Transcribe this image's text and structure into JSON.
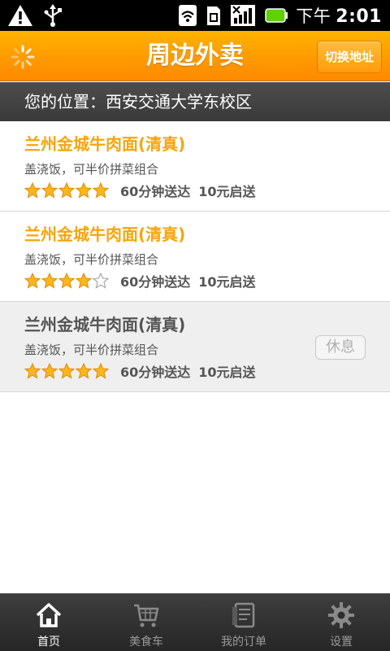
{
  "status_bar": {
    "ampm": "下午",
    "time": "2:01",
    "icons": [
      "warning-icon",
      "usb-icon",
      "wifi-icon",
      "sim-icon",
      "signal-icon",
      "battery-icon"
    ]
  },
  "header": {
    "title": "周边外卖",
    "switch_address": "切换地址",
    "accent": "#ff9a00"
  },
  "location": {
    "label": "您的位置：",
    "value": "西安交通大学东校区"
  },
  "restaurants": [
    {
      "name": "兰州金城牛肉面(清真)",
      "desc": "盖浇饭，可半价拼菜组合",
      "rating": 5,
      "delivery_time": "60分钟送达",
      "min_order": "10元启送",
      "closed": false
    },
    {
      "name": "兰州金城牛肉面(清真)",
      "desc": "盖浇饭，可半价拼菜组合",
      "rating": 4,
      "delivery_time": "60分钟送达",
      "min_order": "10元启送",
      "closed": false
    },
    {
      "name": "兰州金城牛肉面(清真)",
      "desc": "盖浇饭，可半价拼菜组合",
      "rating": 5,
      "delivery_time": "60分钟送达",
      "min_order": "10元启送",
      "closed": true,
      "closed_label": "休息"
    }
  ],
  "tabs": [
    {
      "label": "首页",
      "icon": "home-icon",
      "active": true
    },
    {
      "label": "美食车",
      "icon": "cart-icon",
      "active": false
    },
    {
      "label": "我的订单",
      "icon": "orders-icon",
      "active": false
    },
    {
      "label": "设置",
      "icon": "gear-icon",
      "active": false
    }
  ]
}
